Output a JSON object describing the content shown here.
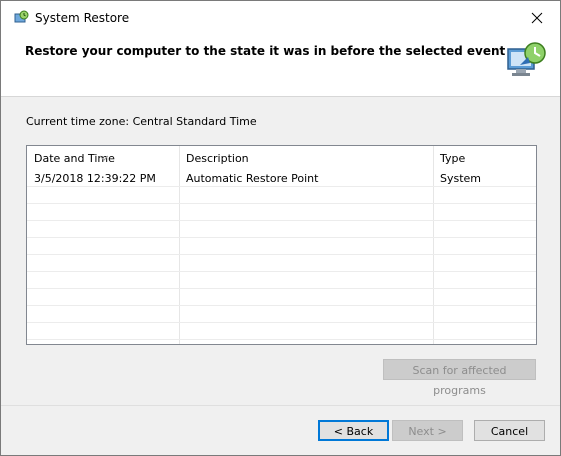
{
  "window": {
    "title": "System Restore"
  },
  "header": {
    "heading": "Restore your computer to the state it was in before the selected event"
  },
  "timezone_label": "Current time zone: Central Standard Time",
  "table": {
    "columns": [
      "Date and Time",
      "Description",
      "Type"
    ],
    "rows": [
      [
        "3/5/2018 12:39:22 PM",
        "Automatic Restore Point",
        "System"
      ]
    ]
  },
  "buttons": {
    "scan": "Scan for affected programs",
    "back": "< Back",
    "next": "Next >",
    "cancel": "Cancel"
  },
  "icons": {
    "app": "system-restore-icon",
    "header": "restore-computer-icon",
    "close": "close-icon",
    "sort": "sort-descending-icon"
  }
}
